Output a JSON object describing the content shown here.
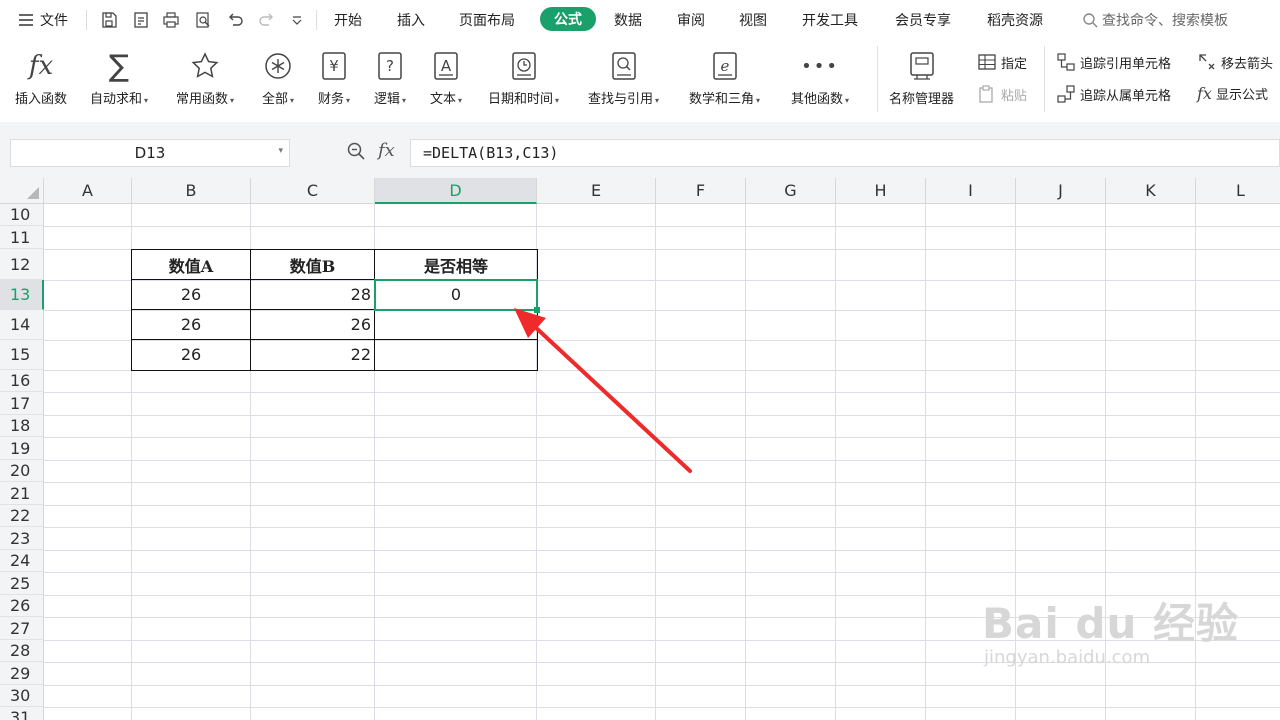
{
  "menu": {
    "file_label": "文件",
    "tabs": [
      {
        "label": "开始",
        "active": false
      },
      {
        "label": "插入",
        "active": false
      },
      {
        "label": "页面布局",
        "active": false
      },
      {
        "label": "公式",
        "active": true
      },
      {
        "label": "数据",
        "active": false
      },
      {
        "label": "审阅",
        "active": false
      },
      {
        "label": "视图",
        "active": false
      },
      {
        "label": "开发工具",
        "active": false
      },
      {
        "label": "会员专享",
        "active": false
      },
      {
        "label": "稻壳资源",
        "active": false
      }
    ],
    "search_placeholder": "查找命令、搜索模板",
    "accent_color": "#1aa06a"
  },
  "ribbon": {
    "insert_function": "插入函数",
    "autosum": "自动求和",
    "common_functions": "常用函数",
    "all": "全部",
    "finance": "财务",
    "logic": "逻辑",
    "text": "文本",
    "datetime": "日期和时间",
    "lookup": "查找与引用",
    "math": "数学和三角",
    "other": "其他函数",
    "name_manager": "名称管理器",
    "specify": "指定",
    "paste": "粘贴",
    "trace_precedents": "追踪引用单元格",
    "trace_dependents": "追踪从属单元格",
    "remove_arrows": "移去箭头",
    "show_formulas": "显示公式"
  },
  "formula_bar": {
    "name_box": "D13",
    "formula": "=DELTA(B13,C13)"
  },
  "grid": {
    "columns": [
      "A",
      "B",
      "C",
      "D",
      "E",
      "F",
      "G",
      "H",
      "I",
      "J",
      "K",
      "L"
    ],
    "selected_column": "D",
    "rows": [
      "10",
      "11",
      "12",
      "13",
      "14",
      "15",
      "16",
      "17",
      "18",
      "19",
      "20",
      "21",
      "22",
      "23",
      "24",
      "25",
      "26",
      "27",
      "28",
      "29",
      "30",
      "31"
    ],
    "selected_row": "13"
  },
  "table": {
    "headers": [
      "数值A",
      "数值B",
      "是否相等"
    ],
    "rows": [
      {
        "a": "26",
        "b": "28",
        "result": "0"
      },
      {
        "a": "26",
        "b": "26",
        "result": ""
      },
      {
        "a": "26",
        "b": "22",
        "result": ""
      }
    ]
  },
  "watermark": {
    "logo_text": "Bai du 经验",
    "url": "jingyan.baidu.com"
  }
}
